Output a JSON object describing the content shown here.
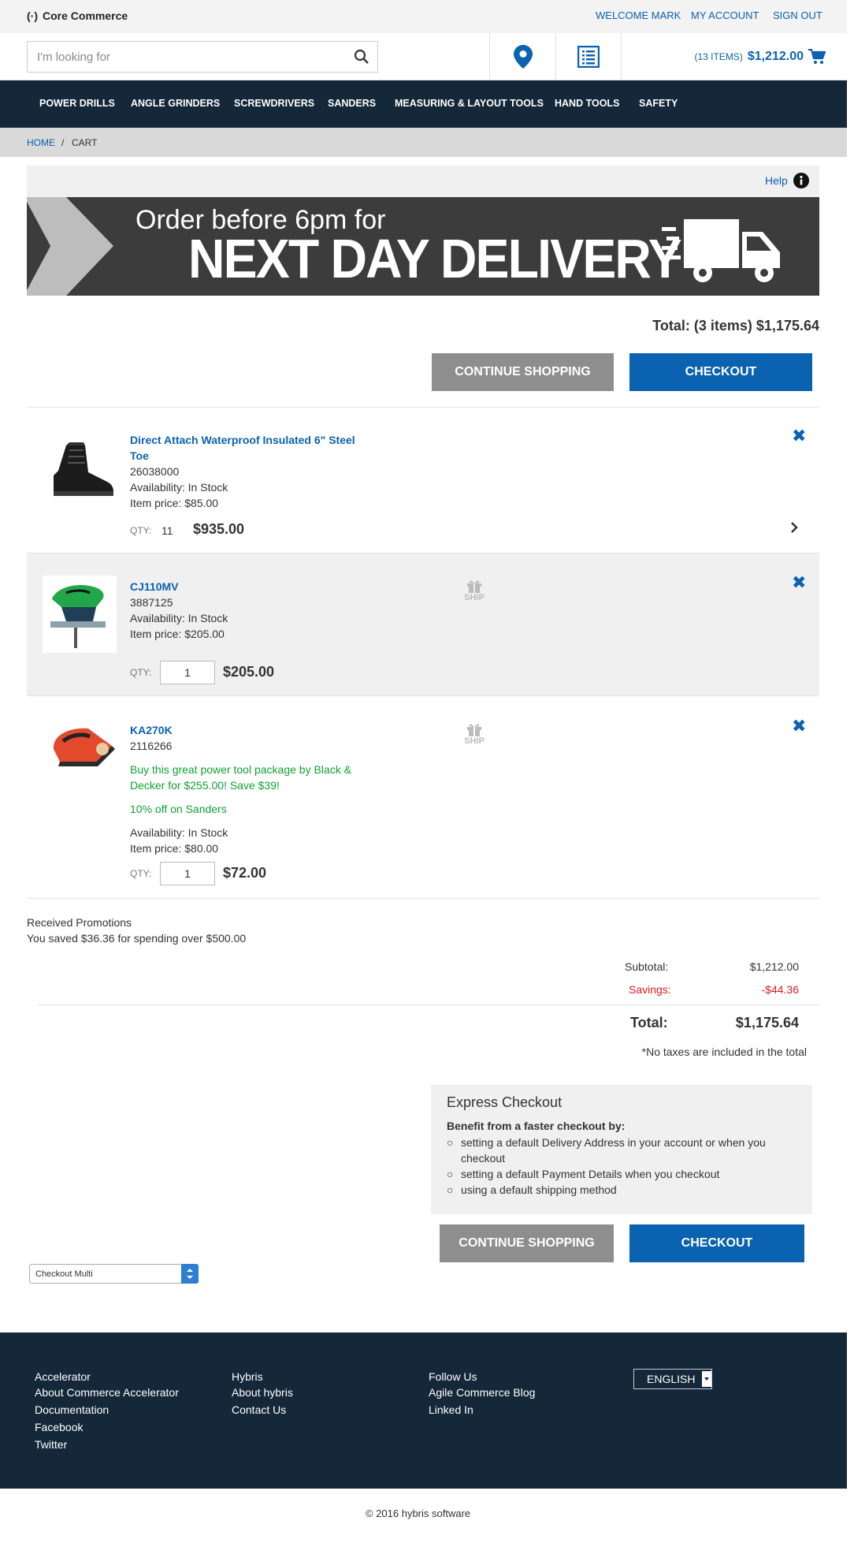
{
  "header": {
    "brand": "Core Commerce",
    "welcome": "WELCOME MARK",
    "my_account": "MY ACCOUNT",
    "sign_out": "SIGN OUT",
    "search_placeholder": "I'm looking for",
    "cart_items": "(13 ITEMS)",
    "cart_total": "$1,212.00"
  },
  "nav": {
    "items": [
      "POWER DRILLS",
      "ANGLE GRINDERS",
      "SCREWDRIVERS",
      "SANDERS",
      "MEASURING & LAYOUT TOOLS",
      "HAND TOOLS",
      "SAFETY"
    ]
  },
  "breadcrumb": {
    "home": "HOME",
    "sep": "/",
    "current": "CART"
  },
  "help": {
    "label": "Help"
  },
  "banner": {
    "line1": "Order before 6pm for",
    "line2": "NEXT DAY DELIVERY"
  },
  "cart": {
    "total_top": "Total: (3 items) $1,175.64",
    "continue_shopping": "CONTINUE SHOPPING",
    "checkout": "CHECKOUT",
    "qty_label": "QTY:",
    "ship_label": "SHIP",
    "items": [
      {
        "title_line1": "Direct Attach Waterproof Insulated 6\" Steel",
        "title_line2": "Toe",
        "code": "26038000",
        "availability": "Availability: In Stock",
        "item_price": "Item price: $85.00",
        "qty": "11",
        "total": "$935.00"
      },
      {
        "title": "CJ110MV",
        "code": "3887125",
        "availability": "Availability: In Stock",
        "item_price": "Item price: $205.00",
        "qty": "1",
        "total": "$205.00"
      },
      {
        "title": "KA270K",
        "code": "2116266",
        "promo_line1": "Buy this great power tool package by Black &",
        "promo_line2": "Decker for $255.00! Save $39!",
        "promo2": "10% off on Sanders",
        "availability": "Availability: In Stock",
        "item_price": "Item price: $80.00",
        "qty": "1",
        "total": "$72.00"
      }
    ]
  },
  "promotions": {
    "heading": "Received Promotions",
    "text": "You saved $36.36 for spending over $500.00"
  },
  "summary": {
    "subtotal_label": "Subtotal:",
    "subtotal": "$1,212.00",
    "savings_label": "Savings:",
    "savings": "-$44.36",
    "total_label": "Total:",
    "total": "$1,175.64",
    "tax_note": "*No taxes are included in the total"
  },
  "express": {
    "title": "Express Checkout",
    "benefit": "Benefit from a faster checkout by:",
    "b1_line1": "setting a default Delivery Address in your account or when you",
    "b1_line2": "checkout",
    "b2": "setting a default Payment Details when you checkout",
    "b3": "using a default shipping method"
  },
  "checkout_select": {
    "value": "Checkout Multi"
  },
  "footer": {
    "col1": [
      "Accelerator",
      "About Commerce Accelerator",
      "Documentation",
      "Facebook",
      "Twitter"
    ],
    "col2": [
      "Hybris",
      "About hybris",
      "Contact Us"
    ],
    "col3": [
      "Follow Us",
      "Agile Commerce Blog",
      "Linked In"
    ],
    "language": "ENGLISH",
    "copyright": "© 2016 hybris software"
  },
  "colors": {
    "brand_blue": "#0a62b0",
    "nav_dark": "#14283a",
    "savings_red": "#e0191a",
    "promo_green": "#11a133"
  }
}
